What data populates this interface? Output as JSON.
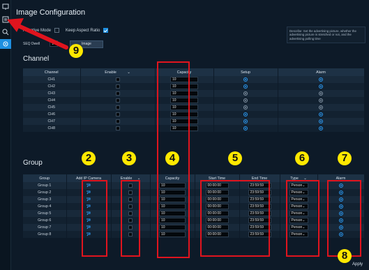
{
  "sidebar": {
    "items": [
      {
        "icon": "monitor-icon"
      },
      {
        "icon": "record-icon"
      },
      {
        "icon": "search-icon"
      },
      {
        "icon": "settings-icon",
        "active": true
      }
    ]
  },
  "page": {
    "title": "Image Configuration",
    "adaptive_mode_label": "Adaptive Mode",
    "keep_aspect_label": "Keep Aspect Ratio",
    "seq_dwell_label": "SEQ Dwell",
    "seq_dwell_value": "1",
    "seq_button_label": "Image",
    "description": "Describe: Set the advertising picture, whether the advertising picture is stretched or not, and the advertising polling time",
    "apply_label": "Apply"
  },
  "channel": {
    "title": "Channel",
    "columns": [
      "Channel",
      "Enable",
      "Capacity",
      "Setup",
      "Alarm"
    ],
    "rows": [
      {
        "name": "CH1",
        "capacity": "10",
        "setup": "blue",
        "alarm": "blue"
      },
      {
        "name": "CH2",
        "capacity": "10",
        "setup": "blue",
        "alarm": "blue"
      },
      {
        "name": "CH3",
        "capacity": "10",
        "setup": "gray",
        "alarm": "gray"
      },
      {
        "name": "CH4",
        "capacity": "10",
        "setup": "gray",
        "alarm": "gray"
      },
      {
        "name": "CH5",
        "capacity": "10",
        "setup": "gray",
        "alarm": "gray"
      },
      {
        "name": "CH6",
        "capacity": "10",
        "setup": "blue",
        "alarm": "blue"
      },
      {
        "name": "CH7",
        "capacity": "10",
        "setup": "blue",
        "alarm": "blue"
      },
      {
        "name": "CH8",
        "capacity": "10",
        "setup": "blue",
        "alarm": "blue"
      }
    ]
  },
  "group": {
    "title": "Group",
    "columns": [
      "Group",
      "Add IP Camera",
      "Enable",
      "Capacity",
      "Start Time",
      "End Time",
      "Type",
      "Alarm"
    ],
    "rows": [
      {
        "name": "Group 1",
        "capacity": "10",
        "start": "00:00:00",
        "end": "23:59:59",
        "type": "Person"
      },
      {
        "name": "Group 2",
        "capacity": "10",
        "start": "00:00:00",
        "end": "23:59:59",
        "type": "Person"
      },
      {
        "name": "Group 3",
        "capacity": "10",
        "start": "00:00:00",
        "end": "23:59:59",
        "type": "Person"
      },
      {
        "name": "Group 4",
        "capacity": "10",
        "start": "00:00:00",
        "end": "23:59:59",
        "type": "Person"
      },
      {
        "name": "Group 5",
        "capacity": "10",
        "start": "00:00:00",
        "end": "23:59:59",
        "type": "Person"
      },
      {
        "name": "Group 6",
        "capacity": "10",
        "start": "00:00:00",
        "end": "23:59:59",
        "type": "Person"
      },
      {
        "name": "Group 7",
        "capacity": "10",
        "start": "00:00:00",
        "end": "23:59:59",
        "type": "Person"
      },
      {
        "name": "Group 8",
        "capacity": "10",
        "start": "00:00:00",
        "end": "23:59:59",
        "type": "Person"
      }
    ]
  },
  "callouts": [
    "2",
    "3",
    "4",
    "5",
    "6",
    "7",
    "8",
    "9"
  ],
  "colors": {
    "accent": "#1e8fe0",
    "callout": "#ffe800",
    "highlight": "#e0141e"
  }
}
